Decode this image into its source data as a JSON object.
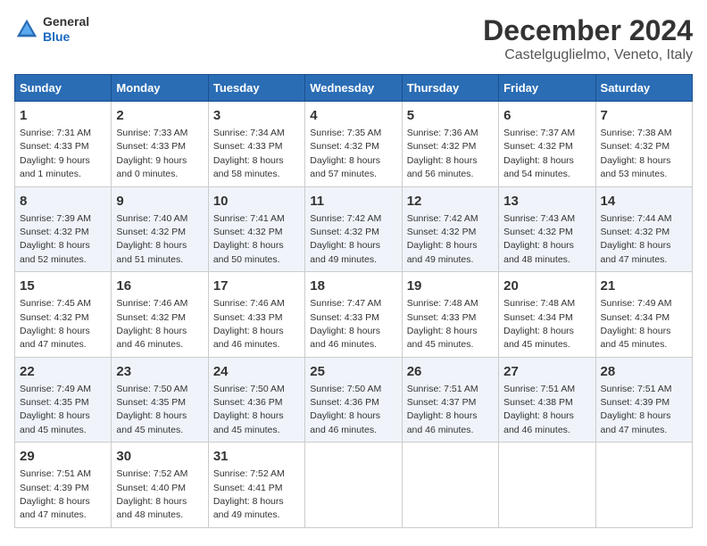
{
  "logo": {
    "general": "General",
    "blue": "Blue"
  },
  "title": "December 2024",
  "subtitle": "Castelguglielmo, Veneto, Italy",
  "days_header": [
    "Sunday",
    "Monday",
    "Tuesday",
    "Wednesday",
    "Thursday",
    "Friday",
    "Saturday"
  ],
  "weeks": [
    [
      {
        "day": "1",
        "sunrise": "7:31 AM",
        "sunset": "4:33 PM",
        "daylight": "9 hours and 1 minute."
      },
      {
        "day": "2",
        "sunrise": "7:33 AM",
        "sunset": "4:33 PM",
        "daylight": "9 hours and 0 minutes."
      },
      {
        "day": "3",
        "sunrise": "7:34 AM",
        "sunset": "4:33 PM",
        "daylight": "8 hours and 58 minutes."
      },
      {
        "day": "4",
        "sunrise": "7:35 AM",
        "sunset": "4:32 PM",
        "daylight": "8 hours and 57 minutes."
      },
      {
        "day": "5",
        "sunrise": "7:36 AM",
        "sunset": "4:32 PM",
        "daylight": "8 hours and 56 minutes."
      },
      {
        "day": "6",
        "sunrise": "7:37 AM",
        "sunset": "4:32 PM",
        "daylight": "8 hours and 54 minutes."
      },
      {
        "day": "7",
        "sunrise": "7:38 AM",
        "sunset": "4:32 PM",
        "daylight": "8 hours and 53 minutes."
      }
    ],
    [
      {
        "day": "8",
        "sunrise": "7:39 AM",
        "sunset": "4:32 PM",
        "daylight": "8 hours and 52 minutes."
      },
      {
        "day": "9",
        "sunrise": "7:40 AM",
        "sunset": "4:32 PM",
        "daylight": "8 hours and 51 minutes."
      },
      {
        "day": "10",
        "sunrise": "7:41 AM",
        "sunset": "4:32 PM",
        "daylight": "8 hours and 50 minutes."
      },
      {
        "day": "11",
        "sunrise": "7:42 AM",
        "sunset": "4:32 PM",
        "daylight": "8 hours and 49 minutes."
      },
      {
        "day": "12",
        "sunrise": "7:42 AM",
        "sunset": "4:32 PM",
        "daylight": "8 hours and 49 minutes."
      },
      {
        "day": "13",
        "sunrise": "7:43 AM",
        "sunset": "4:32 PM",
        "daylight": "8 hours and 48 minutes."
      },
      {
        "day": "14",
        "sunrise": "7:44 AM",
        "sunset": "4:32 PM",
        "daylight": "8 hours and 47 minutes."
      }
    ],
    [
      {
        "day": "15",
        "sunrise": "7:45 AM",
        "sunset": "4:32 PM",
        "daylight": "8 hours and 47 minutes."
      },
      {
        "day": "16",
        "sunrise": "7:46 AM",
        "sunset": "4:32 PM",
        "daylight": "8 hours and 46 minutes."
      },
      {
        "day": "17",
        "sunrise": "7:46 AM",
        "sunset": "4:33 PM",
        "daylight": "8 hours and 46 minutes."
      },
      {
        "day": "18",
        "sunrise": "7:47 AM",
        "sunset": "4:33 PM",
        "daylight": "8 hours and 46 minutes."
      },
      {
        "day": "19",
        "sunrise": "7:48 AM",
        "sunset": "4:33 PM",
        "daylight": "8 hours and 45 minutes."
      },
      {
        "day": "20",
        "sunrise": "7:48 AM",
        "sunset": "4:34 PM",
        "daylight": "8 hours and 45 minutes."
      },
      {
        "day": "21",
        "sunrise": "7:49 AM",
        "sunset": "4:34 PM",
        "daylight": "8 hours and 45 minutes."
      }
    ],
    [
      {
        "day": "22",
        "sunrise": "7:49 AM",
        "sunset": "4:35 PM",
        "daylight": "8 hours and 45 minutes."
      },
      {
        "day": "23",
        "sunrise": "7:50 AM",
        "sunset": "4:35 PM",
        "daylight": "8 hours and 45 minutes."
      },
      {
        "day": "24",
        "sunrise": "7:50 AM",
        "sunset": "4:36 PM",
        "daylight": "8 hours and 45 minutes."
      },
      {
        "day": "25",
        "sunrise": "7:50 AM",
        "sunset": "4:36 PM",
        "daylight": "8 hours and 46 minutes."
      },
      {
        "day": "26",
        "sunrise": "7:51 AM",
        "sunset": "4:37 PM",
        "daylight": "8 hours and 46 minutes."
      },
      {
        "day": "27",
        "sunrise": "7:51 AM",
        "sunset": "4:38 PM",
        "daylight": "8 hours and 46 minutes."
      },
      {
        "day": "28",
        "sunrise": "7:51 AM",
        "sunset": "4:39 PM",
        "daylight": "8 hours and 47 minutes."
      }
    ],
    [
      {
        "day": "29",
        "sunrise": "7:51 AM",
        "sunset": "4:39 PM",
        "daylight": "8 hours and 47 minutes."
      },
      {
        "day": "30",
        "sunrise": "7:52 AM",
        "sunset": "4:40 PM",
        "daylight": "8 hours and 48 minutes."
      },
      {
        "day": "31",
        "sunrise": "7:52 AM",
        "sunset": "4:41 PM",
        "daylight": "8 hours and 49 minutes."
      },
      null,
      null,
      null,
      null
    ]
  ]
}
